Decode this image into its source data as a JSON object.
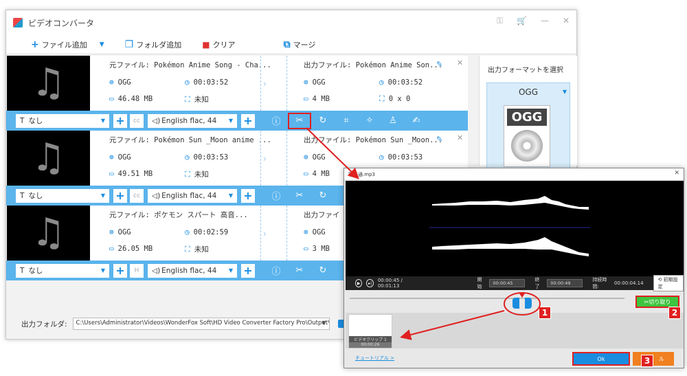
{
  "app": {
    "title": "ビデオコンバータ"
  },
  "toolbar": {
    "add_file": "ファイル追加",
    "add_folder": "フォルダ追加",
    "clear": "クリア",
    "merge": "マージ"
  },
  "items": [
    {
      "src_name": "元ファイル: Pokémon Anime Song - Cha...",
      "src_format": "OGG",
      "src_duration": "00:03:52",
      "src_size": "46.48 MB",
      "src_res": "未知",
      "out_name": "出力ファイル: Pokémon Anime Son...",
      "out_format": "OGG",
      "out_duration": "00:03:52",
      "out_size": "4 MB",
      "out_res": "0 x 0",
      "subtitle": "なし",
      "audio": "English flac, 44"
    },
    {
      "src_name": "元ファイル: Pokémon Sun _Moon anime ...",
      "src_format": "OGG",
      "src_duration": "00:03:53",
      "src_size": "49.51 MB",
      "src_res": "未知",
      "out_name": "出力ファイル: Pokémon Sun _Moon...",
      "out_format": "OGG",
      "out_duration": "00:03:53",
      "out_size": "4 MB",
      "out_res": "",
      "subtitle": "なし",
      "audio": "English flac, 44"
    },
    {
      "src_name": "元ファイル: ポケモン スパート 高音...",
      "src_format": "OGG",
      "src_duration": "00:02:59",
      "src_size": "26.05 MB",
      "src_res": "未知",
      "out_name": "出力ファイ",
      "out_format": "OGG",
      "out_duration": "",
      "out_size": "3 MB",
      "out_res": "",
      "subtitle": "なし",
      "audio": "English flac, 44"
    }
  ],
  "side": {
    "title": "出力フォーマットを選択",
    "format": "OGG",
    "icon_label": "OGG"
  },
  "output": {
    "label": "出力フォルダ:",
    "path": "C:\\Users\\Administrator\\Videos\\WonderFox Soft\\HD Video Converter Factory Pro\\OutputVideo\\"
  },
  "dialog": {
    "title": "歌手通.mp3",
    "time": "00:00:45 / 00:01:13",
    "start_label": "開始",
    "start_value": "00:00:45",
    "end_label": "終了",
    "end_value": "00:00:49",
    "duration_label": "持続時間:",
    "duration_value": "00:00:04.14",
    "reset": "初期設定",
    "cut": "切り取り",
    "clip_label": "ビデオクリップ 1",
    "clip_time": "00:00:26",
    "tutorial": "チュートリアル >",
    "ok": "Ok",
    "cancel": "ル"
  },
  "badges": [
    "1",
    "2",
    "3"
  ],
  "colors": {
    "accent": "#1a8de0",
    "bar": "#5bb4ec",
    "highlight": "#e02020",
    "cut_green": "#3ec43e",
    "cancel_orange": "#f08020"
  }
}
